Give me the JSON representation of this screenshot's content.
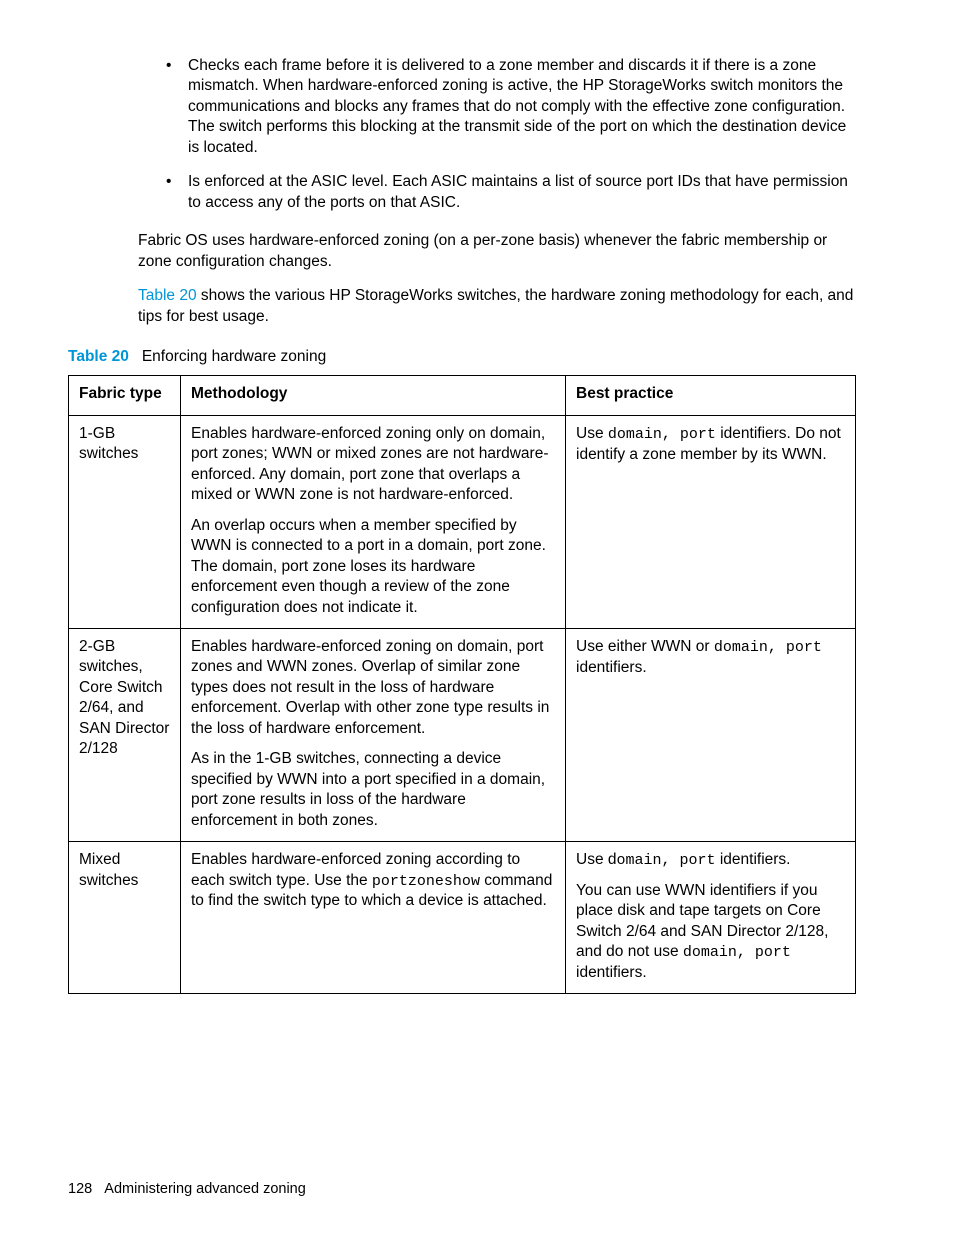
{
  "bullets": [
    "Checks each frame before it is delivered to a zone member and discards it if there is a zone mismatch. When hardware-enforced zoning is active, the HP StorageWorks switch monitors the communications and blocks any frames that do not comply with the effective zone configuration. The switch performs this blocking at the transmit side of the port on which the destination device is located.",
    "Is enforced at the ASIC level. Each ASIC maintains a list of source port IDs that have permission to access any of the ports on that ASIC."
  ],
  "para1": "Fabric OS uses hardware-enforced zoning (on a per-zone basis) whenever the fabric membership or zone configuration changes.",
  "para2_link": "Table 20",
  "para2_rest": " shows the various HP StorageWorks switches, the hardware zoning methodology for each, and tips for best usage.",
  "caption_label": "Table 20",
  "caption_text": "Enforcing hardware zoning",
  "headers": {
    "c1": "Fabric type",
    "c2": "Methodology",
    "c3": "Best practice"
  },
  "rows": {
    "r1": {
      "fabric": "1-GB switches",
      "method_p1": "Enables hardware-enforced zoning only on domain, port zones; WWN or mixed zones are not hardware-enforced. Any domain, port zone that overlaps a mixed or WWN zone is not hardware-enforced.",
      "method_p2": "An overlap occurs when a member specified by WWN is connected to a port in a domain, port zone. The domain, port zone loses its hardware enforcement even though a review of the zone configuration does not indicate it.",
      "best_pre": "Use ",
      "best_code": "domain, port",
      "best_post": " identifiers. Do not identify a zone member by its WWN."
    },
    "r2": {
      "fabric": "2-GB switches, Core Switch 2/64, and SAN Director 2/128",
      "method_p1": "Enables hardware-enforced zoning on domain, port zones and WWN zones. Overlap of similar zone types does not result in the loss of hardware enforcement. Overlap with other zone type results in the loss of hardware enforcement.",
      "method_p2": "As in the 1-GB switches, connecting a device specified by WWN into a port specified in a domain, port zone results in loss of the hardware enforcement in both zones.",
      "best_pre": "Use either WWN or ",
      "best_code": "domain, port",
      "best_post": " identifiers."
    },
    "r3": {
      "fabric": "Mixed switches",
      "method_pre": "Enables hardware-enforced zoning according to each switch type. Use the ",
      "method_code": "portzoneshow",
      "method_post": " command to find the switch type to which a device is attached.",
      "best_p1_pre": "Use d",
      "best_p1_code": "omain, port",
      "best_p1_post": " identifiers.",
      "best_p2_pre": "You can use WWN identifiers if you place disk and tape targets on Core Switch 2/64 and SAN Director 2/128, and do not use ",
      "best_p2_code": "domain, port",
      "best_p2_post": " identifiers."
    }
  },
  "footer_page": "128",
  "footer_text": "Administering advanced zoning"
}
